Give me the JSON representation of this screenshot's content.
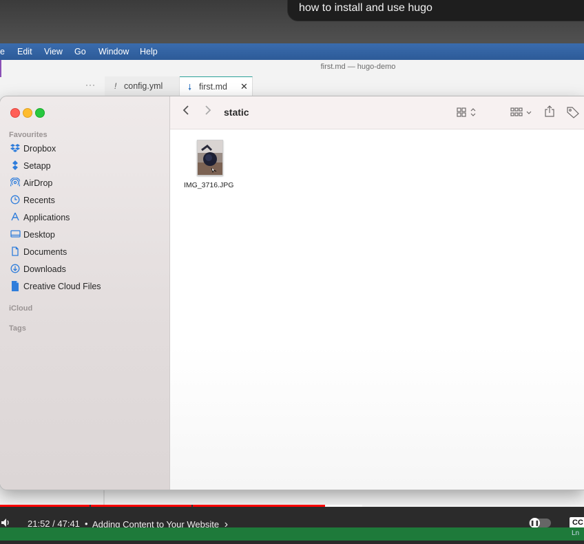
{
  "video_title": "how to install and use hugo",
  "menubar": {
    "items": [
      "e",
      "Edit",
      "View",
      "Go",
      "Window",
      "Help"
    ]
  },
  "editor": {
    "window_title": "first.md — hugo-demo",
    "more_label": "···",
    "tabs": [
      {
        "icon": "!",
        "label": "config.yml"
      },
      {
        "icon": "🠗",
        "label": "first.md",
        "close": "✕"
      }
    ]
  },
  "finder": {
    "location": "static",
    "sidebar": {
      "favourites_heading": "Favourites",
      "items": [
        {
          "label": "Dropbox",
          "icon": "dropbox-icon"
        },
        {
          "label": "Setapp",
          "icon": "setapp-icon"
        },
        {
          "label": "AirDrop",
          "icon": "airdrop-icon"
        },
        {
          "label": "Recents",
          "icon": "clock-icon"
        },
        {
          "label": "Applications",
          "icon": "applications-icon"
        },
        {
          "label": "Desktop",
          "icon": "desktop-icon"
        },
        {
          "label": "Documents",
          "icon": "document-icon"
        },
        {
          "label": "Downloads",
          "icon": "download-icon"
        },
        {
          "label": "Creative Cloud Files",
          "icon": "file-icon"
        }
      ],
      "icloud_heading": "iCloud",
      "tags_heading": "Tags"
    },
    "files": [
      {
        "name": "IMG_3716.JPG"
      }
    ]
  },
  "player": {
    "time": "21:52 / 47:41",
    "separator": "•",
    "chapter": "Adding Content to Your Website",
    "chapter_arrow": "›",
    "played_fraction": 0.458,
    "cc_label": "CC",
    "status_text": "Ln"
  },
  "colors": {
    "progress": "#ff0000",
    "menubar": "#2d5b98",
    "statusbar": "#1e7a3a"
  }
}
